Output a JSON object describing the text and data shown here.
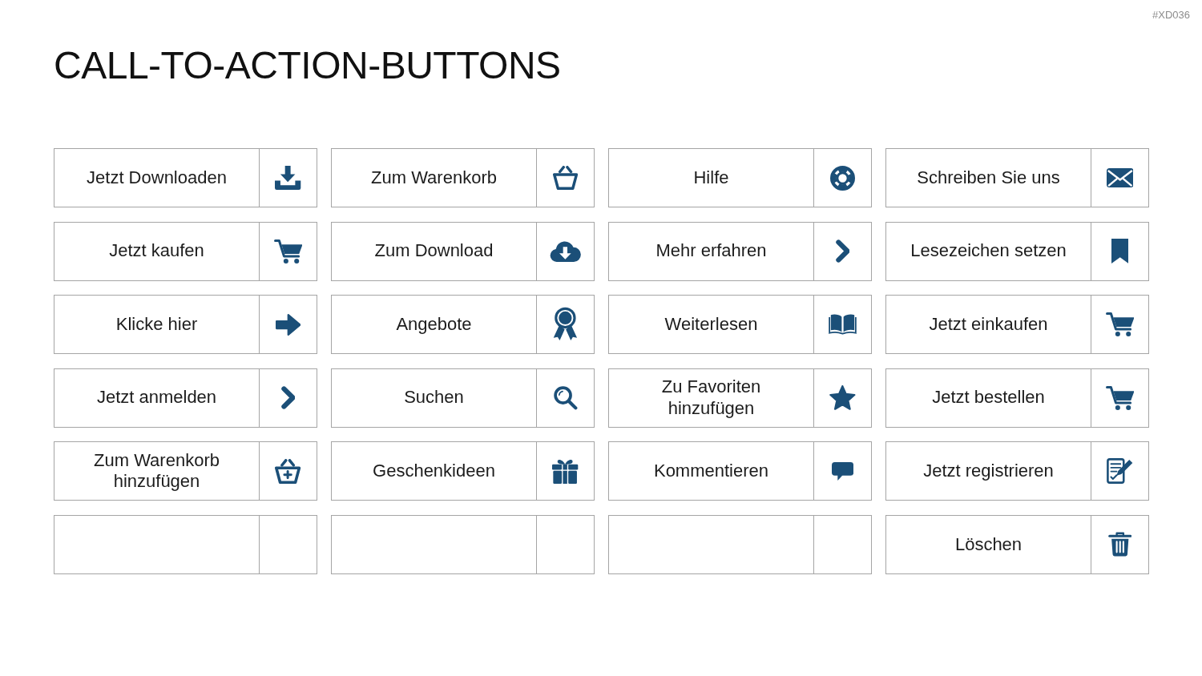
{
  "slide_code": "#XD036",
  "title": "CALL-TO-ACTION-BUTTONS",
  "buttons": [
    {
      "label": "Jetzt Downloaden",
      "kind": "download"
    },
    {
      "label": "Zum Warenkorb",
      "kind": "basket"
    },
    {
      "label": "Hilfe",
      "kind": "lifebuoy"
    },
    {
      "label": "Schreiben Sie uns",
      "kind": "envelope"
    },
    {
      "label": "Jetzt kaufen",
      "kind": "cart"
    },
    {
      "label": "Zum Download",
      "kind": "cloud-download"
    },
    {
      "label": "Mehr erfahren",
      "kind": "chevron"
    },
    {
      "label": "Lesezeichen setzen",
      "kind": "bookmark"
    },
    {
      "label": "Klicke hier",
      "kind": "arrow"
    },
    {
      "label": "Angebote",
      "kind": "award"
    },
    {
      "label": "Weiterlesen",
      "kind": "book"
    },
    {
      "label": "Jetzt einkaufen",
      "kind": "cart"
    },
    {
      "label": "Jetzt anmelden",
      "kind": "chevron"
    },
    {
      "label": "Suchen",
      "kind": "search"
    },
    {
      "label": "Zu Favoriten hinzufügen",
      "kind": "star"
    },
    {
      "label": "Jetzt bestellen",
      "kind": "cart"
    },
    {
      "label": "Zum Warenkorb hinzufügen",
      "kind": "basket-plus"
    },
    {
      "label": "Geschenkideen",
      "kind": "gift"
    },
    {
      "label": "Kommentieren",
      "kind": "comment"
    },
    {
      "label": "Jetzt registrieren",
      "kind": "form-pen"
    },
    {
      "kind": "blank"
    },
    {
      "kind": "blank"
    },
    {
      "kind": "blank"
    },
    {
      "label": "Löschen",
      "kind": "trash"
    }
  ]
}
